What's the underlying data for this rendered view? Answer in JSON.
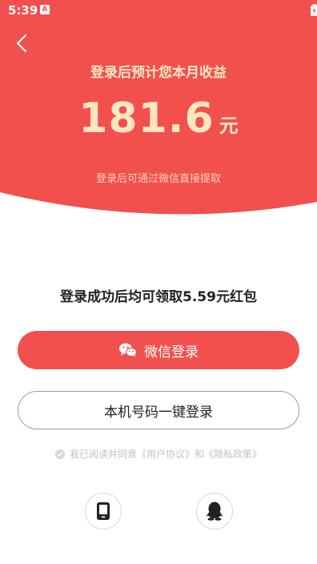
{
  "status_bar": {
    "time": "5:39",
    "notification_icon": "A"
  },
  "hero": {
    "title": "登录后预计您本月收益",
    "amount": "181.6",
    "unit": "元",
    "subtitle": "登录后可通过微信直接提取"
  },
  "promo": "登录成功后均可领取5.59元红包",
  "buttons": {
    "wechat_label": "微信登录",
    "phone_label": "本机号码一键登录"
  },
  "agreement": "我已阅读并同意《用户协议》和《隐私政策》",
  "colors": {
    "accent": "#f2504e",
    "gold": "#ffe6c2"
  },
  "icons": [
    "back-icon",
    "wechat-icon",
    "phone-icon",
    "qq-icon",
    "wifi-icon",
    "signal-icon",
    "battery-icon",
    "check-icon"
  ]
}
